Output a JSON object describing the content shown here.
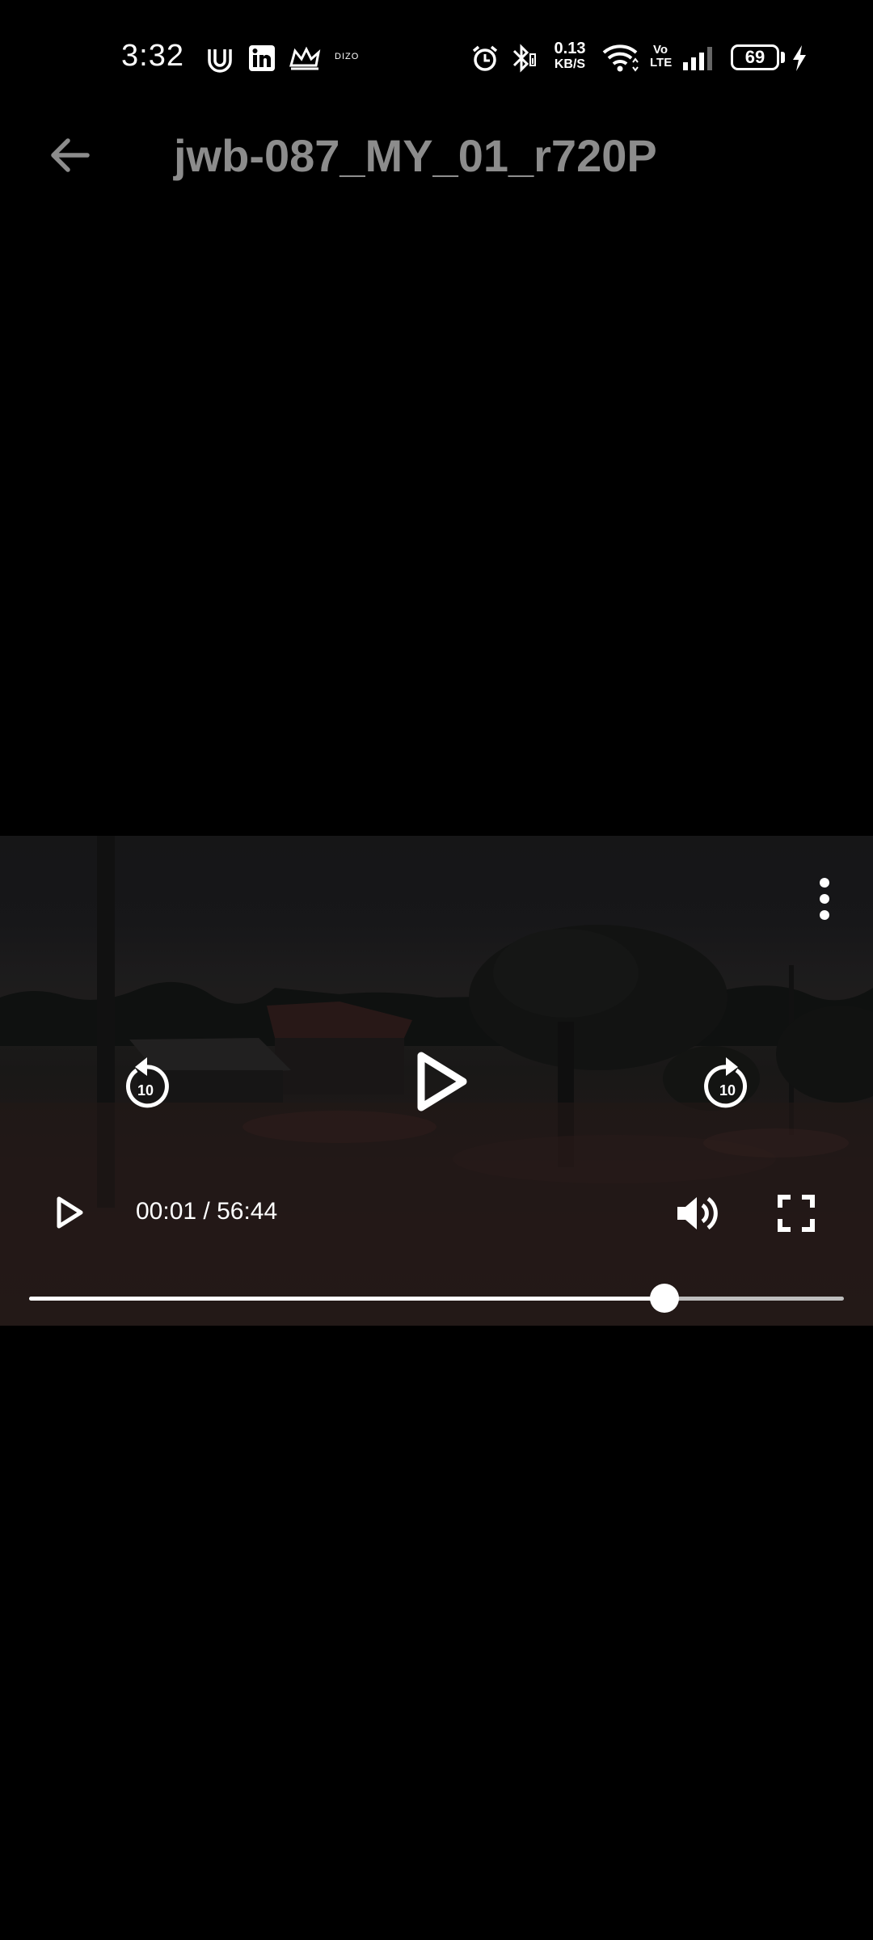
{
  "status_bar": {
    "time": "3:32",
    "dizo_label": "DIZO",
    "net_speed_value": "0.13",
    "net_speed_unit": "KB/S",
    "volte_top": "Vo",
    "volte_bottom": "LTE",
    "battery_level": "69",
    "battery_fraction": 0.69,
    "icons": [
      "notification-app-icon",
      "linkedin-icon",
      "crown-app-icon",
      "alarm-icon",
      "bluetooth-icon",
      "wifi-icon",
      "signal-icon",
      "charging-icon"
    ]
  },
  "app_bar": {
    "title": "jwb-087_MY_01_r720P",
    "back_icon": "arrow-back-icon"
  },
  "player": {
    "current_time": "00:01",
    "separator": "/",
    "duration": "56:44",
    "time_display": "00:01 / 56:44",
    "rewind_seconds": "10",
    "forward_seconds": "10",
    "progress_fraction": 0.78,
    "icons": [
      "more-vert-icon",
      "replay-10-icon",
      "play-icon",
      "forward-10-icon",
      "play-small-icon",
      "volume-icon",
      "fullscreen-icon"
    ]
  }
}
